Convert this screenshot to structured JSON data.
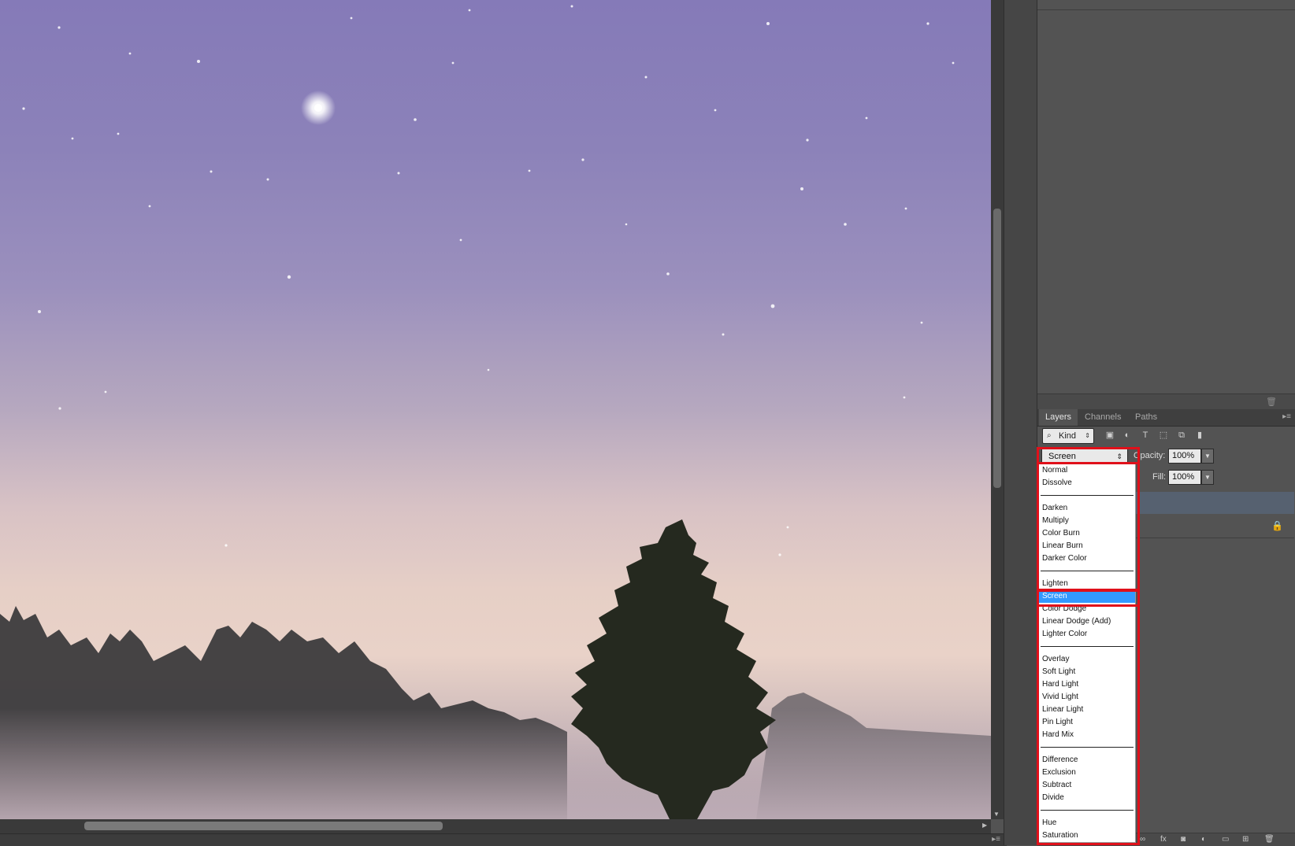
{
  "panel_tabs": [
    {
      "label": "Layers",
      "active": true
    },
    {
      "label": "Channels",
      "active": false
    },
    {
      "label": "Paths",
      "active": false
    }
  ],
  "filter": {
    "kind_label": "Kind"
  },
  "blend": {
    "current": "Screen"
  },
  "opacity": {
    "label": "Opacity:",
    "value": "100%"
  },
  "fill": {
    "label": "Fill:",
    "value": "100%"
  },
  "blend_groups": [
    [
      "Normal",
      "Dissolve"
    ],
    [
      "Darken",
      "Multiply",
      "Color Burn",
      "Linear Burn",
      "Darker Color"
    ],
    [
      "Lighten",
      "Screen",
      "Color Dodge",
      "Linear Dodge (Add)",
      "Lighter Color"
    ],
    [
      "Overlay",
      "Soft Light",
      "Hard Light",
      "Vivid Light",
      "Linear Light",
      "Pin Light",
      "Hard Mix"
    ],
    [
      "Difference",
      "Exclusion",
      "Subtract",
      "Divide"
    ],
    [
      "Hue",
      "Saturation"
    ]
  ],
  "colors": {
    "highlight": "#e0101a",
    "selected": "#3399ff"
  }
}
